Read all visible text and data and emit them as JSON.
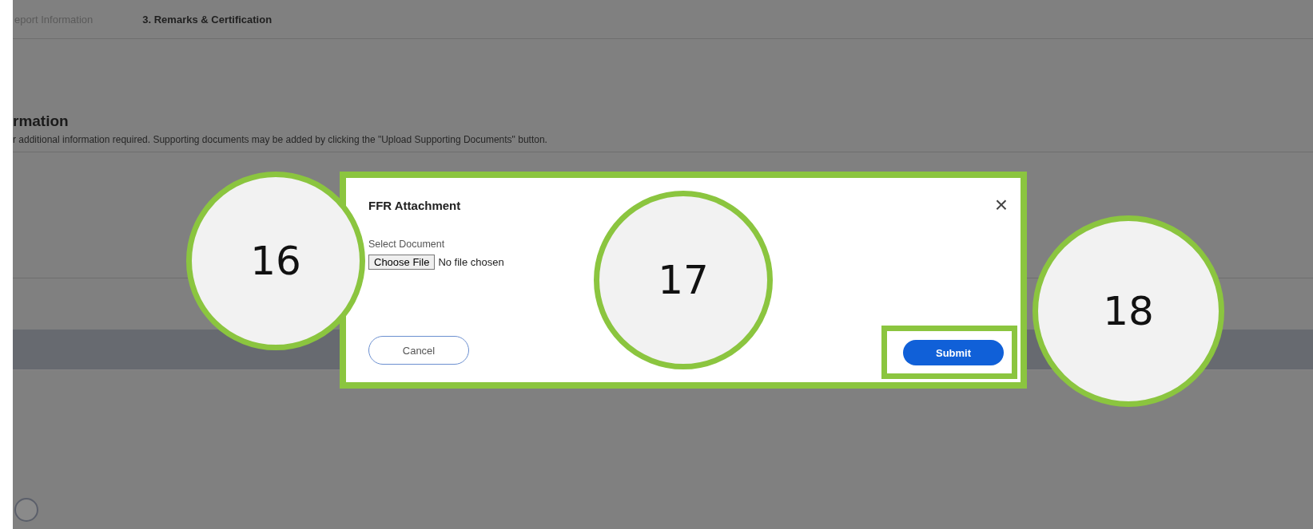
{
  "tabs": [
    {
      "label": "eport Information",
      "selected": false
    },
    {
      "label": "3. Remarks & Certification",
      "selected": true
    }
  ],
  "section": {
    "title": "rmation",
    "description": "r additional information required. Supporting documents may be added by clicking the \"Upload Supporting Documents\" button."
  },
  "dialog": {
    "title": "FFR Attachment",
    "close": "×",
    "field_label": "Select Document",
    "file_button": "Choose File",
    "file_status": "No file chosen",
    "cancel": "Cancel",
    "submit": "Submit"
  },
  "radio": {
    "checked": false
  },
  "callouts": [
    "16",
    "17",
    "18"
  ]
}
